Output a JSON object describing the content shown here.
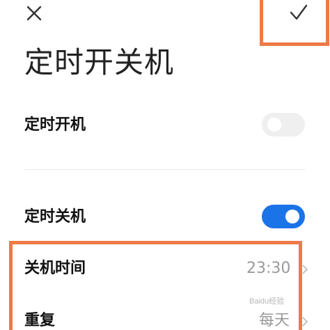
{
  "header": {
    "close_icon": "close-icon",
    "confirm_icon": "check-icon"
  },
  "page": {
    "title": "定时开关机"
  },
  "settings": {
    "scheduled_power_on": {
      "label": "定时开机",
      "enabled": false
    },
    "scheduled_power_off": {
      "label": "定时关机",
      "enabled": true
    },
    "shutdown_time": {
      "label": "关机时间",
      "value": "23:30"
    },
    "repeat": {
      "label": "重复",
      "value": "每天"
    }
  },
  "colors": {
    "accent": "#1b73e8",
    "toggle_off": "#efefef",
    "highlight": "#ee7a46",
    "text": "#111111",
    "secondary_text": "#9a9a9a"
  },
  "watermark": {
    "text": "Baidu经验"
  }
}
